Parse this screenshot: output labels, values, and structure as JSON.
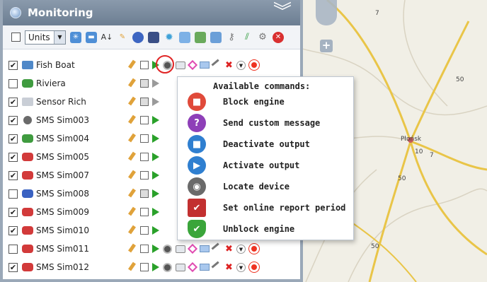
{
  "panel": {
    "title": "Monitoring",
    "header_icon": "globe-icon",
    "collapse_icon": "double-chevron-up-icon"
  },
  "toolbar": {
    "units_select": "Units",
    "icons": [
      "expand-icon",
      "collapse-icon",
      "sort-az-icon",
      "edit-icon",
      "record-icon",
      "card-icon",
      "settings-gear-icon",
      "window-icon",
      "map-icon",
      "group-icon",
      "key-icon",
      "road-icon",
      "link-icon",
      "delete-icon"
    ]
  },
  "units": [
    {
      "name": "Fish Boat",
      "checked": true,
      "icon": "boat-icon",
      "command_checked": false
    },
    {
      "name": "Riviera",
      "checked": false,
      "icon": "car-green-icon",
      "command_checked": false
    },
    {
      "name": "Sensor Rich",
      "checked": true,
      "icon": "sensor-icon",
      "command_checked": false
    },
    {
      "name": "SMS Sim003",
      "checked": true,
      "icon": "sim-icon",
      "command_checked": false
    },
    {
      "name": "SMS Sim004",
      "checked": true,
      "icon": "car-green-icon",
      "command_checked": false
    },
    {
      "name": "SMS Sim005",
      "checked": true,
      "icon": "car-red-icon",
      "command_checked": false
    },
    {
      "name": "SMS Sim007",
      "checked": true,
      "icon": "car-red-icon",
      "command_checked": false
    },
    {
      "name": "SMS Sim008",
      "checked": false,
      "icon": "car-blue-icon",
      "command_checked": false
    },
    {
      "name": "SMS Sim009",
      "checked": true,
      "icon": "car-red-icon",
      "command_checked": false
    },
    {
      "name": "SMS Sim010",
      "checked": true,
      "icon": "car-red-icon",
      "command_checked": false
    },
    {
      "name": "SMS Sim011",
      "checked": false,
      "icon": "car-red-icon",
      "command_checked": false
    },
    {
      "name": "SMS Sim012",
      "checked": true,
      "icon": "car-red-icon",
      "command_checked": false
    }
  ],
  "commands_popup": {
    "title": "Available commands:",
    "items": [
      {
        "label": "Block engine",
        "icon": "block-engine-icon",
        "color": "#e04a3a"
      },
      {
        "label": "Send custom message",
        "icon": "question-icon",
        "color": "#8e3fb8"
      },
      {
        "label": "Deactivate output",
        "icon": "stop-icon",
        "color": "#2f7fd0"
      },
      {
        "label": "Activate output",
        "icon": "play-icon",
        "color": "#2f7fd0"
      },
      {
        "label": "Locate device",
        "icon": "binoculars-icon",
        "color": "#6a6a6a"
      },
      {
        "label": "Set online report period",
        "icon": "clipboard-check-icon",
        "color": "#c23030"
      },
      {
        "label": "Unblock engine",
        "icon": "shield-check-icon",
        "color": "#3aa53a"
      }
    ]
  },
  "map": {
    "city_label": "Płońsk",
    "road_labels": [
      "7",
      "50",
      "10",
      "7",
      "50",
      "50"
    ],
    "zoom_in_label": "+"
  }
}
